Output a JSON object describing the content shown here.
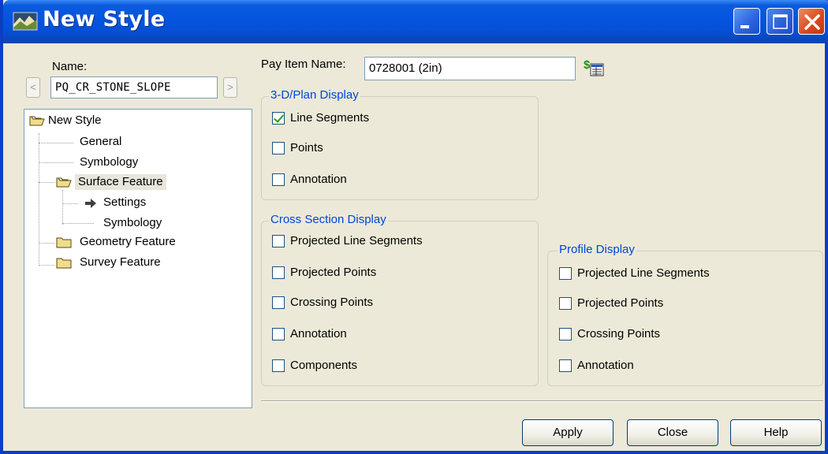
{
  "window": {
    "title": "New Style"
  },
  "name_field": {
    "label": "Name:",
    "value": "PQ_CR_STONE_SLOPE",
    "prev_symbol": "<",
    "next_symbol": ">"
  },
  "tree": {
    "items": [
      {
        "label": "New Style",
        "type": "folder-open"
      },
      {
        "label": "General",
        "type": "leaf"
      },
      {
        "label": "Symbology",
        "type": "leaf"
      },
      {
        "label": "Surface Feature",
        "type": "folder-open",
        "selected": true
      },
      {
        "label": "Settings",
        "type": "arrow-leaf"
      },
      {
        "label": "Symbology",
        "type": "leaf"
      },
      {
        "label": "Geometry Feature",
        "type": "folder"
      },
      {
        "label": "Survey Feature",
        "type": "folder"
      }
    ]
  },
  "pay_item": {
    "label": "Pay Item Name:",
    "value": "0728001 (2in)",
    "icon": "pay-item-lookup-icon"
  },
  "plan_display": {
    "title": "3-D/Plan Display",
    "options": [
      {
        "label": "Line Segments",
        "checked": true
      },
      {
        "label": "Points",
        "checked": false
      },
      {
        "label": "Annotation",
        "checked": false
      }
    ]
  },
  "cross_section_display": {
    "title": "Cross Section Display",
    "options": [
      {
        "label": "Projected Line Segments",
        "checked": false
      },
      {
        "label": "Projected Points",
        "checked": false
      },
      {
        "label": "Crossing Points",
        "checked": false
      },
      {
        "label": "Annotation",
        "checked": false
      },
      {
        "label": "Components",
        "checked": false
      }
    ]
  },
  "profile_display": {
    "title": "Profile Display",
    "options": [
      {
        "label": "Projected Line Segments",
        "checked": false
      },
      {
        "label": "Projected Points",
        "checked": false
      },
      {
        "label": "Crossing Points",
        "checked": false
      },
      {
        "label": "Annotation",
        "checked": false
      }
    ]
  },
  "buttons": {
    "apply": "Apply",
    "close": "Close",
    "help": "Help"
  },
  "colors": {
    "titlebar": "#0655e0",
    "group_title": "#0046d5",
    "check": "#21a121",
    "dialog_bg": "#ece9d8"
  }
}
